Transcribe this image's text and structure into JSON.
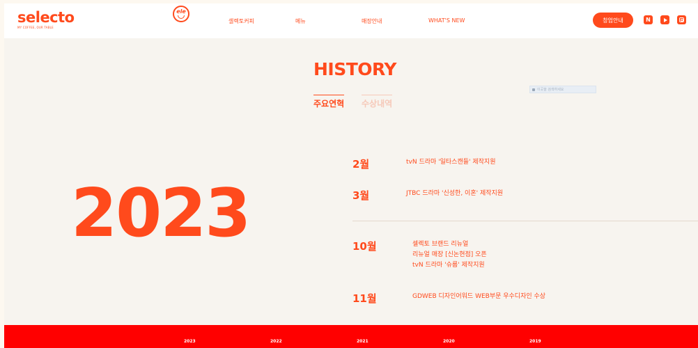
{
  "header": {
    "logo": {
      "word": "selecto",
      "tagline": "MY COFFEE, OUR TABLE"
    },
    "badge_text": "ele",
    "nav": [
      {
        "label": "셀렉토커피"
      },
      {
        "label": "메뉴"
      },
      {
        "label": "매장안내"
      },
      {
        "label": "WHAT'S NEW"
      }
    ],
    "cta_label": "창업안내",
    "sns": [
      {
        "icon": "naver-icon",
        "glyph": "N"
      },
      {
        "icon": "youtube-icon"
      },
      {
        "icon": "instagram-icon"
      }
    ]
  },
  "page": {
    "title": "HISTORY",
    "tabs": [
      {
        "label": "주요연혁",
        "active": true
      },
      {
        "label": "수상내역",
        "active": false
      }
    ],
    "search_placeholder": "이곳을 검색하세요"
  },
  "history": {
    "year": "2023",
    "groups": [
      {
        "entries": [
          {
            "month": "2월",
            "events": [
              "tvN 드라마 '일타스캔들' 제작지원"
            ]
          },
          {
            "month": "3월",
            "events": [
              "JTBC 드라마 '신성한, 이혼' 제작지원"
            ]
          }
        ]
      },
      {
        "entries": [
          {
            "month": "10월",
            "events": [
              "셀렉토 브랜드 리뉴얼",
              "리뉴얼 매장 [신논현점] 오픈",
              "tvN 드라마 '슈룹' 제작지원"
            ]
          },
          {
            "month": "11월",
            "events": [
              "GDWEB 디자인어워드 WEB부문 우수디자인 수상"
            ]
          }
        ]
      }
    ]
  },
  "year_nav": [
    {
      "label": "2023"
    },
    {
      "label": "2022"
    },
    {
      "label": "2021"
    },
    {
      "label": "2020"
    },
    {
      "label": "2019"
    }
  ],
  "colors": {
    "accent": "#ff4a1c",
    "bottom_bar": "#ff0000",
    "page_bg": "#f7f4ef",
    "header_bg": "#ffffff",
    "inactive_tab": "#f6c8b8"
  }
}
